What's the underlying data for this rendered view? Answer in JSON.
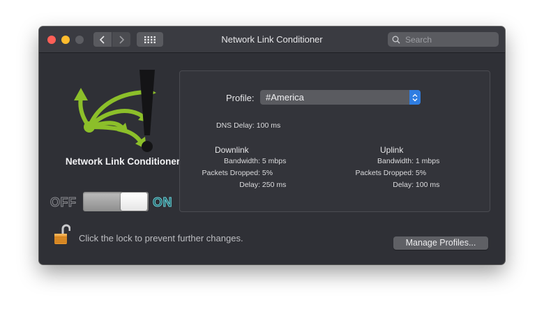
{
  "window": {
    "title": "Network Link Conditioner",
    "search_placeholder": "Search"
  },
  "sidebar": {
    "app_name": "Network Link Conditioner",
    "toggle_off_label": "OFF",
    "toggle_on_label": "ON",
    "toggle_state": "on"
  },
  "settings": {
    "profile_label": "Profile:",
    "profile_value": "#America",
    "dns_delay_label": "DNS Delay:",
    "dns_delay_value": "100 ms",
    "downlink": {
      "heading": "Downlink",
      "bandwidth_label": "Bandwidth:",
      "bandwidth_value": "5 mbps",
      "packets_dropped_label": "Packets Dropped:",
      "packets_dropped_value": "5%",
      "delay_label": "Delay:",
      "delay_value": "250 ms"
    },
    "uplink": {
      "heading": "Uplink",
      "bandwidth_label": "Bandwidth:",
      "bandwidth_value": "1 mbps",
      "packets_dropped_label": "Packets Dropped:",
      "packets_dropped_value": "5%",
      "delay_label": "Delay:",
      "delay_value": "100 ms"
    }
  },
  "footer": {
    "lock_text": "Click the lock to prevent further changes.",
    "manage_profiles_label": "Manage Profiles..."
  },
  "icons": {
    "logo": "network-link-conditioner-logo",
    "lock": "unlocked-padlock-icon"
  },
  "colors": {
    "accent_blue": "#2f7de1",
    "on_label": "#6fd0d8",
    "logo_green": "#8cbf2a"
  }
}
